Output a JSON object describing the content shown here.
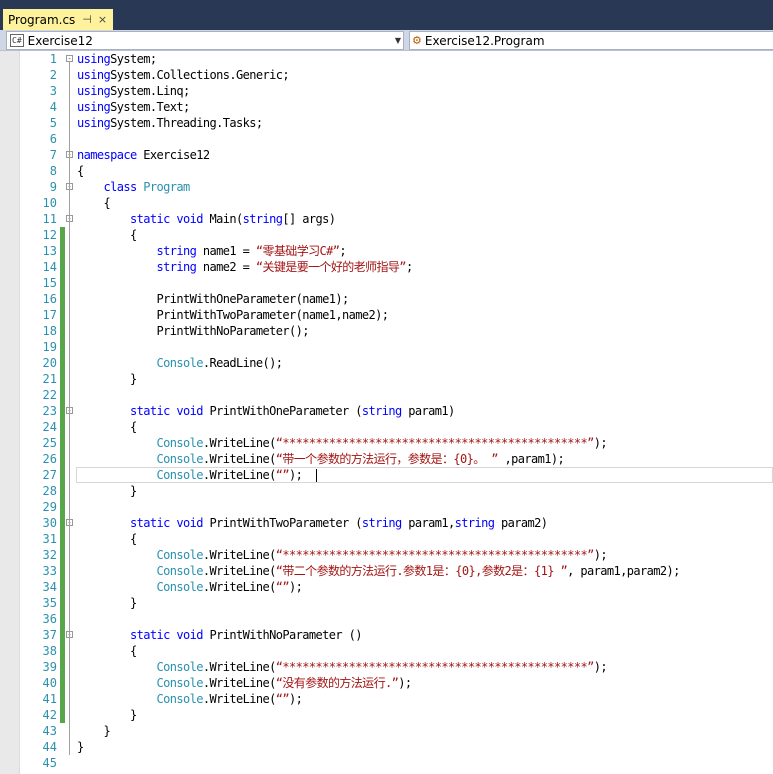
{
  "tab": {
    "label": "Program.cs",
    "pin_glyph": "⊣",
    "close_glyph": "×"
  },
  "nav": {
    "left": "Exercise12",
    "right": "Exercise12.Program"
  },
  "colors": {
    "keyword": "#0000ff",
    "type": "#2b91af",
    "string": "#a31515",
    "change_bar": "#57a64a",
    "line_number": "#2b91af"
  },
  "code_lines": [
    {
      "num": "1",
      "changed": false,
      "fold": "-",
      "tokens": [
        [
          "kw",
          "using"
        ],
        [
          "",
          "System;"
        ]
      ]
    },
    {
      "num": "2",
      "changed": false,
      "fold": "",
      "tokens": [
        [
          "kw",
          "using"
        ],
        [
          "",
          "System.Collections.Generic;"
        ]
      ]
    },
    {
      "num": "3",
      "changed": false,
      "fold": "",
      "tokens": [
        [
          "kw",
          "using"
        ],
        [
          "",
          "System.Linq;"
        ]
      ]
    },
    {
      "num": "4",
      "changed": false,
      "fold": "",
      "tokens": [
        [
          "kw",
          "using"
        ],
        [
          "",
          "System.Text;"
        ]
      ]
    },
    {
      "num": "5",
      "changed": false,
      "fold": "",
      "tokens": [
        [
          "kw",
          "using"
        ],
        [
          "",
          "System.Threading.Tasks;"
        ]
      ]
    },
    {
      "num": "6",
      "changed": false,
      "fold": "",
      "tokens": []
    },
    {
      "num": "7",
      "changed": false,
      "fold": "-",
      "tokens": [
        [
          "kw",
          "namespace"
        ],
        [
          "",
          " Exercise12"
        ]
      ]
    },
    {
      "num": "8",
      "changed": false,
      "fold": "",
      "tokens": [
        [
          "",
          "{"
        ]
      ]
    },
    {
      "num": "9",
      "changed": false,
      "fold": "-",
      "tokens": [
        [
          "",
          "    "
        ],
        [
          "kw",
          "class"
        ],
        [
          "",
          " "
        ],
        [
          "ty",
          "Program"
        ]
      ]
    },
    {
      "num": "10",
      "changed": false,
      "fold": "",
      "tokens": [
        [
          "",
          "    {"
        ]
      ]
    },
    {
      "num": "11",
      "changed": false,
      "fold": "-",
      "tokens": [
        [
          "",
          "        "
        ],
        [
          "kw",
          "static"
        ],
        [
          "",
          " "
        ],
        [
          "kw",
          "void"
        ],
        [
          "",
          " Main("
        ],
        [
          "kw",
          "string"
        ],
        [
          "",
          "[] args)"
        ]
      ]
    },
    {
      "num": "12",
      "changed": true,
      "fold": "",
      "tokens": [
        [
          "",
          "        {"
        ]
      ]
    },
    {
      "num": "13",
      "changed": true,
      "fold": "",
      "tokens": [
        [
          "",
          "            "
        ],
        [
          "kw",
          "string"
        ],
        [
          "",
          " name1 = "
        ],
        [
          "st",
          "“零基础学习C#”"
        ],
        [
          "",
          ";"
        ]
      ]
    },
    {
      "num": "14",
      "changed": true,
      "fold": "",
      "tokens": [
        [
          "",
          "            "
        ],
        [
          "kw",
          "string"
        ],
        [
          "",
          " name2 = "
        ],
        [
          "st",
          "“关键是要一个好的老师指导”"
        ],
        [
          "",
          ";"
        ]
      ]
    },
    {
      "num": "15",
      "changed": true,
      "fold": "",
      "tokens": []
    },
    {
      "num": "16",
      "changed": true,
      "fold": "",
      "tokens": [
        [
          "",
          "            PrintWithOneParameter(name1);"
        ]
      ]
    },
    {
      "num": "17",
      "changed": true,
      "fold": "",
      "tokens": [
        [
          "",
          "            PrintWithTwoParameter(name1,name2);"
        ]
      ]
    },
    {
      "num": "18",
      "changed": true,
      "fold": "",
      "tokens": [
        [
          "",
          "            PrintWithNoParameter();"
        ]
      ]
    },
    {
      "num": "19",
      "changed": true,
      "fold": "",
      "tokens": []
    },
    {
      "num": "20",
      "changed": true,
      "fold": "",
      "tokens": [
        [
          "",
          "            "
        ],
        [
          "ty",
          "Console"
        ],
        [
          "",
          ".ReadLine();"
        ]
      ]
    },
    {
      "num": "21",
      "changed": true,
      "fold": "",
      "tokens": [
        [
          "",
          "        }"
        ]
      ]
    },
    {
      "num": "22",
      "changed": true,
      "fold": "",
      "tokens": []
    },
    {
      "num": "23",
      "changed": true,
      "fold": "-",
      "tokens": [
        [
          "",
          "        "
        ],
        [
          "kw",
          "static"
        ],
        [
          "",
          " "
        ],
        [
          "kw",
          "void"
        ],
        [
          "",
          " PrintWithOneParameter ("
        ],
        [
          "kw",
          "string"
        ],
        [
          "",
          " param1)"
        ]
      ]
    },
    {
      "num": "24",
      "changed": true,
      "fold": "",
      "tokens": [
        [
          "",
          "        {"
        ]
      ]
    },
    {
      "num": "25",
      "changed": true,
      "fold": "",
      "tokens": [
        [
          "",
          "            "
        ],
        [
          "ty",
          "Console"
        ],
        [
          "",
          ".WriteLine("
        ],
        [
          "st",
          "“**********************************************”"
        ],
        [
          "",
          ");"
        ]
      ]
    },
    {
      "num": "26",
      "changed": true,
      "fold": "",
      "tokens": [
        [
          "",
          "            "
        ],
        [
          "ty",
          "Console"
        ],
        [
          "",
          ".WriteLine("
        ],
        [
          "st",
          "“带一个参数的方法运行，参数是：{0}。 ”"
        ],
        [
          "",
          " ,param1);"
        ]
      ]
    },
    {
      "num": "27",
      "changed": true,
      "fold": "",
      "tokens": [
        [
          "",
          "            "
        ],
        [
          "ty",
          "Console"
        ],
        [
          "",
          ".WriteLine("
        ],
        [
          "st",
          "“”"
        ],
        [
          "",
          ");"
        ]
      ]
    },
    {
      "num": "28",
      "changed": true,
      "fold": "",
      "tokens": [
        [
          "",
          "        }"
        ]
      ]
    },
    {
      "num": "29",
      "changed": true,
      "fold": "",
      "tokens": []
    },
    {
      "num": "30",
      "changed": true,
      "fold": "-",
      "tokens": [
        [
          "",
          "        "
        ],
        [
          "kw",
          "static"
        ],
        [
          "",
          " "
        ],
        [
          "kw",
          "void"
        ],
        [
          "",
          " PrintWithTwoParameter ("
        ],
        [
          "kw",
          "string"
        ],
        [
          "",
          " param1,"
        ],
        [
          "kw",
          "string"
        ],
        [
          "",
          " param2)"
        ]
      ]
    },
    {
      "num": "31",
      "changed": true,
      "fold": "",
      "tokens": [
        [
          "",
          "        {"
        ]
      ]
    },
    {
      "num": "32",
      "changed": true,
      "fold": "",
      "tokens": [
        [
          "",
          "            "
        ],
        [
          "ty",
          "Console"
        ],
        [
          "",
          ".WriteLine("
        ],
        [
          "st",
          "“**********************************************”"
        ],
        [
          "",
          ");"
        ]
      ]
    },
    {
      "num": "33",
      "changed": true,
      "fold": "",
      "tokens": [
        [
          "",
          "            "
        ],
        [
          "ty",
          "Console"
        ],
        [
          "",
          ".WriteLine("
        ],
        [
          "st",
          "“带二个参数的方法运行.参数1是：{0},参数2是：{1} ”"
        ],
        [
          "",
          ", param1,param2);"
        ]
      ]
    },
    {
      "num": "34",
      "changed": true,
      "fold": "",
      "tokens": [
        [
          "",
          "            "
        ],
        [
          "ty",
          "Console"
        ],
        [
          "",
          ".WriteLine("
        ],
        [
          "st",
          "“”"
        ],
        [
          "",
          ");"
        ]
      ]
    },
    {
      "num": "35",
      "changed": true,
      "fold": "",
      "tokens": [
        [
          "",
          "        }"
        ]
      ]
    },
    {
      "num": "36",
      "changed": true,
      "fold": "",
      "tokens": []
    },
    {
      "num": "37",
      "changed": true,
      "fold": "-",
      "tokens": [
        [
          "",
          "        "
        ],
        [
          "kw",
          "static"
        ],
        [
          "",
          " "
        ],
        [
          "kw",
          "void"
        ],
        [
          "",
          " PrintWithNoParameter ()"
        ]
      ]
    },
    {
      "num": "38",
      "changed": true,
      "fold": "",
      "tokens": [
        [
          "",
          "        {"
        ]
      ]
    },
    {
      "num": "39",
      "changed": true,
      "fold": "",
      "tokens": [
        [
          "",
          "            "
        ],
        [
          "ty",
          "Console"
        ],
        [
          "",
          ".WriteLine("
        ],
        [
          "st",
          "“**********************************************”"
        ],
        [
          "",
          ");"
        ]
      ]
    },
    {
      "num": "40",
      "changed": true,
      "fold": "",
      "tokens": [
        [
          "",
          "            "
        ],
        [
          "ty",
          "Console"
        ],
        [
          "",
          ".WriteLine("
        ],
        [
          "st",
          "“没有参数的方法运行.”"
        ],
        [
          "",
          ");"
        ]
      ]
    },
    {
      "num": "41",
      "changed": true,
      "fold": "",
      "tokens": [
        [
          "",
          "            "
        ],
        [
          "ty",
          "Console"
        ],
        [
          "",
          ".WriteLine("
        ],
        [
          "st",
          "“”"
        ],
        [
          "",
          ");"
        ]
      ]
    },
    {
      "num": "42",
      "changed": true,
      "fold": "",
      "tokens": [
        [
          "",
          "        }"
        ]
      ]
    },
    {
      "num": "43",
      "changed": false,
      "fold": "",
      "tokens": [
        [
          "",
          "    }"
        ]
      ]
    },
    {
      "num": "44",
      "changed": false,
      "fold": "",
      "tokens": [
        [
          "",
          "}"
        ]
      ]
    },
    {
      "num": "45",
      "changed": false,
      "fold": "",
      "tokens": []
    }
  ]
}
